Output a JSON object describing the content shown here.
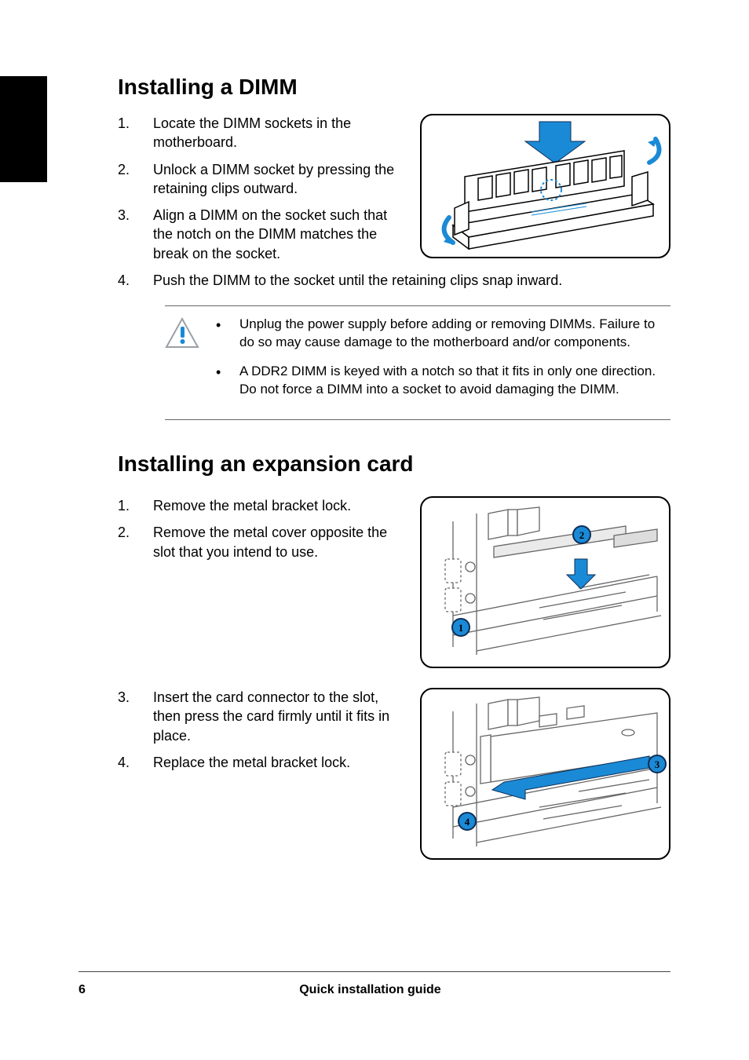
{
  "section1": {
    "heading": "Installing a DIMM",
    "steps": [
      "Locate the DIMM sockets in the motherboard.",
      "Unlock a DIMM socket by pressing the retaining clips outward.",
      "Align a DIMM on the socket such that the notch on the DIMM matches the break on the socket.",
      "Push the DIMM to the socket until the retaining clips snap inward."
    ],
    "notes": [
      "Unplug the power supply before adding or removing DIMMs. Failure to do so may cause damage to the motherboard and/or components.",
      "A DDR2 DIMM is keyed with a notch so that it fits in only one direction. Do not force a DIMM into a socket to avoid damaging the DIMM."
    ]
  },
  "section2": {
    "heading": "Installing an expansion card",
    "steps_a": [
      "Remove the metal bracket lock.",
      "Remove the metal cover opposite the slot that you intend to use."
    ],
    "steps_b": [
      "Insert the card connector to the slot, then press the card firmly until it fits in place.",
      "Replace the metal bracket lock."
    ],
    "fig1_labels": [
      "1",
      "2"
    ],
    "fig2_labels": [
      "3",
      "4"
    ]
  },
  "footer": {
    "page_number": "6",
    "title": "Quick installation guide"
  },
  "icons": {
    "warning": "warning-triangle-icon",
    "dimm_figure": "dimm-install-diagram",
    "expansion_figure_1": "expansion-card-slot-diagram",
    "expansion_figure_2": "expansion-card-insert-diagram"
  },
  "colors": {
    "accent": "#1b8ad6",
    "label_outline": "#0d2e57"
  }
}
